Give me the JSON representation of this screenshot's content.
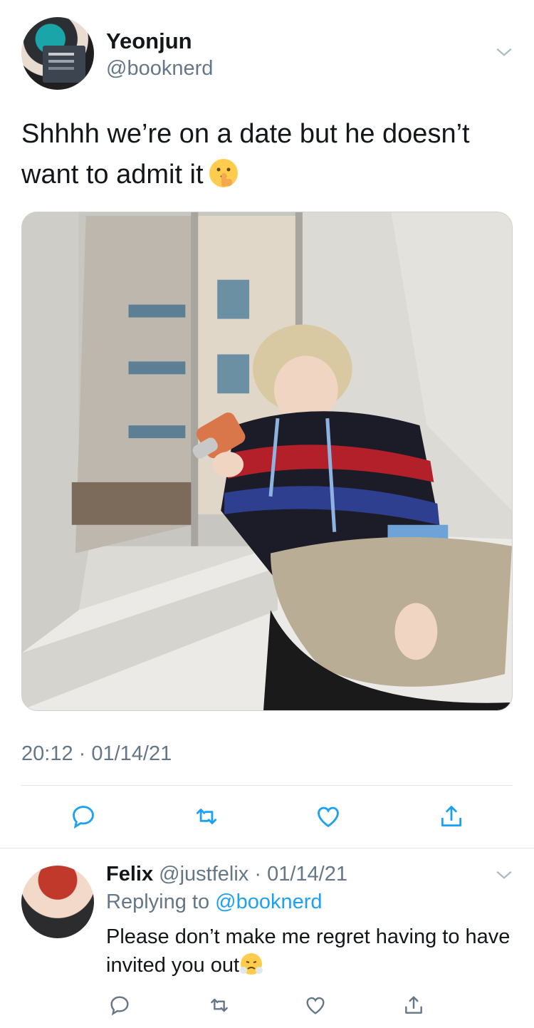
{
  "tweet": {
    "author_name": "Yeonjun",
    "author_handle": "@booknerd",
    "text": "Shhhh we’re on a date but he doesn’t want to admit it",
    "emoji": "shushing-face",
    "timestamp": "20:12 · 01/14/21",
    "image_icon": "photo-person-drinking-by-window",
    "actions": [
      "reply-icon",
      "retweet-icon",
      "like-icon",
      "share-icon"
    ]
  },
  "reply": {
    "author_name": "Felix",
    "author_meta": "@justfelix · 01/14/21",
    "replying_prefix": "Replying to",
    "replying_handle": "@booknerd",
    "text": "Please don’t make me regret having to have invited you out",
    "emoji": "face-with-steam-from-nose",
    "actions": [
      "reply-icon",
      "retweet-icon",
      "like-icon",
      "share-icon"
    ]
  },
  "colors": {
    "text": "#14171a",
    "secondary": "#657786",
    "link": "#1da1f2",
    "divider": "#e1e8ed"
  }
}
